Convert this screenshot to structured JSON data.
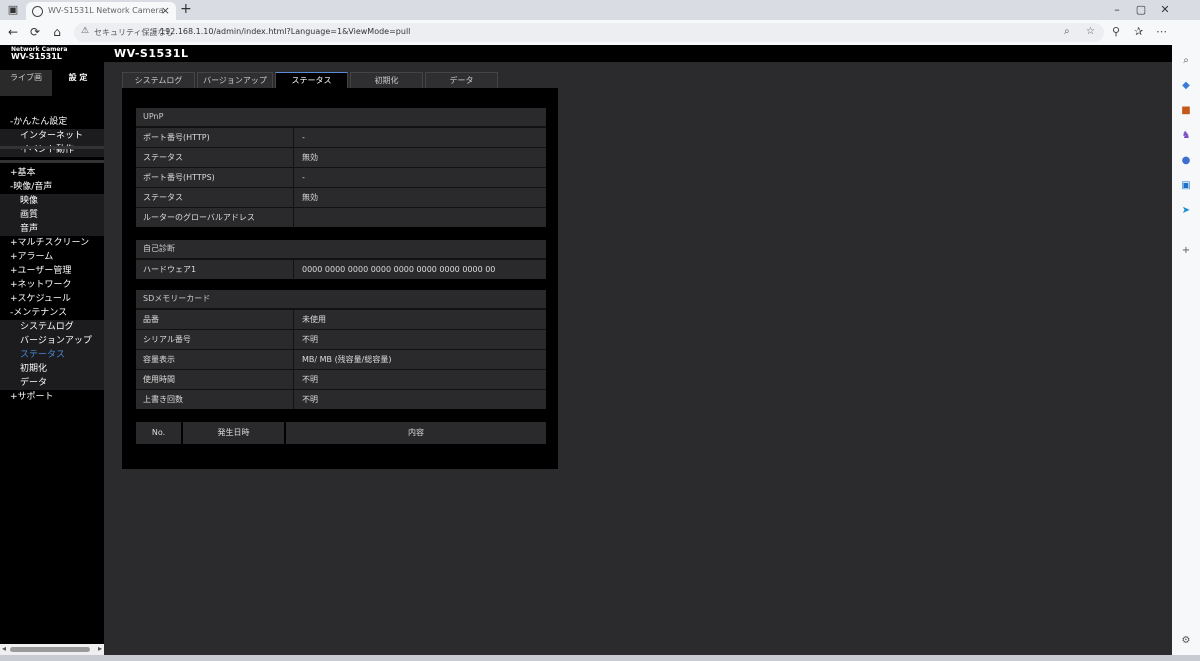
{
  "browser": {
    "tab_title": "WV-S1531L Network Camera",
    "tab_close": "×",
    "new_tab": "+",
    "security_label": "セキュリティ保護なし",
    "url": "192.168.1.10/admin/index.html?Language=1&ViewMode=pull"
  },
  "camera": {
    "brand_line1": "Network Camera",
    "brand_line2": "WV-S1531L",
    "model_title": "WV-S1531L"
  },
  "sidebar": {
    "tab_live": "ライブ画",
    "tab_setup": "設 定",
    "items": [
      {
        "label": "-かんたん設定",
        "type": "group"
      },
      {
        "label": "インターネット",
        "type": "sub"
      },
      {
        "label": "イベント動作",
        "type": "sub"
      },
      {
        "label": "+基本",
        "type": "group"
      },
      {
        "label": "-映像/音声",
        "type": "group"
      },
      {
        "label": "映像",
        "type": "sub"
      },
      {
        "label": "画質",
        "type": "sub"
      },
      {
        "label": "音声",
        "type": "sub"
      },
      {
        "label": "+マルチスクリーン",
        "type": "group"
      },
      {
        "label": "+アラーム",
        "type": "group"
      },
      {
        "label": "+ユーザー管理",
        "type": "group"
      },
      {
        "label": "+ネットワーク",
        "type": "group"
      },
      {
        "label": "+スケジュール",
        "type": "group"
      },
      {
        "label": "-メンテナンス",
        "type": "group"
      },
      {
        "label": "システムログ",
        "type": "sub"
      },
      {
        "label": "バージョンアップ",
        "type": "sub"
      },
      {
        "label": "ステータス",
        "type": "sub-active"
      },
      {
        "label": "初期化",
        "type": "sub"
      },
      {
        "label": "データ",
        "type": "sub"
      },
      {
        "label": "+サポート",
        "type": "group"
      }
    ]
  },
  "tabs": [
    "システムログ",
    "バージョンアップ",
    "ステータス",
    "初期化",
    "データ"
  ],
  "selected_tab": "ステータス",
  "upnp": {
    "title": "UPnP",
    "rows": [
      {
        "label": "ポート番号(HTTP)",
        "value": "-"
      },
      {
        "label": "ステータス",
        "value": "無効"
      },
      {
        "label": "ポート番号(HTTPS)",
        "value": "-"
      },
      {
        "label": "ステータス",
        "value": "無効"
      },
      {
        "label": "ルーターのグローバルアドレス",
        "value": ""
      }
    ]
  },
  "self_diag": {
    "title": "自己診断",
    "rows": [
      {
        "label": "ハードウェア1",
        "value": "0000 0000 0000 0000 0000 0000 0000 0000 00"
      }
    ]
  },
  "sd": {
    "title": "SDメモリーカード",
    "rows": [
      {
        "label": "品番",
        "value": "未使用"
      },
      {
        "label": "シリアル番号",
        "value": "不明"
      },
      {
        "label": "容量表示",
        "value": "MB/  MB (残容量/総容量)"
      },
      {
        "label": "使用時間",
        "value": "不明"
      },
      {
        "label": "上書き回数",
        "value": "不明"
      }
    ]
  },
  "log_table": {
    "col_no": "No.",
    "col_time": "発生日時",
    "col_content": "内容"
  }
}
